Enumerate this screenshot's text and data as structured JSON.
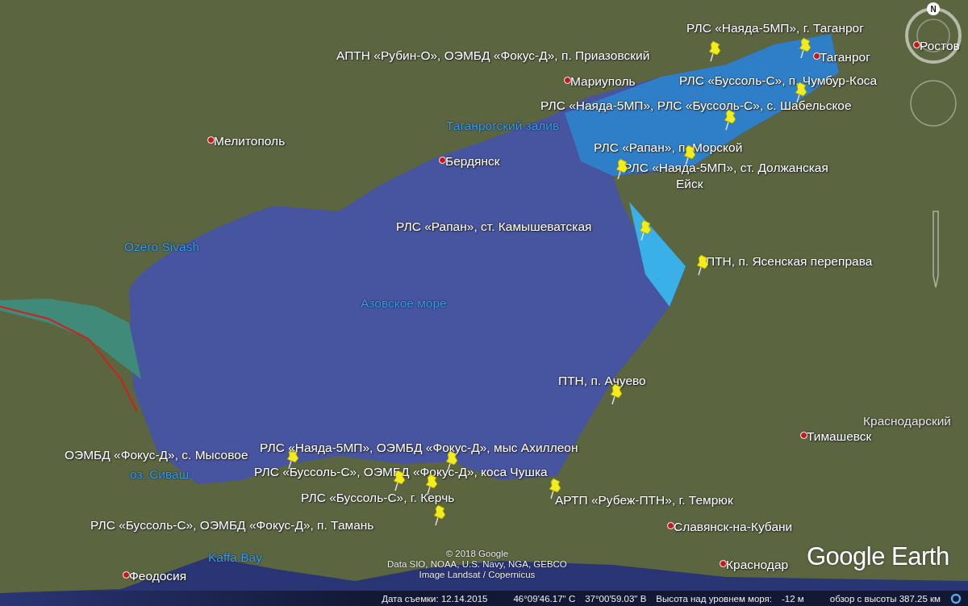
{
  "places": [
    {
      "text": "Таганрог",
      "kind": "city"
    },
    {
      "text": "Ростов",
      "kind": "city"
    },
    {
      "text": "Мариуполь",
      "kind": "city"
    },
    {
      "text": "Таганрогский залив",
      "kind": "water"
    },
    {
      "text": "Мелитополь",
      "kind": "city"
    },
    {
      "text": "Бердянск",
      "kind": "city"
    },
    {
      "text": "Ейск",
      "kind": "town"
    },
    {
      "text": "Ozero Sivash",
      "kind": "water"
    },
    {
      "text": "Азовское море",
      "kind": "water"
    },
    {
      "text": "Краснодарский",
      "kind": "region"
    },
    {
      "text": "Тимашевск",
      "kind": "city"
    },
    {
      "text": "оз. Сиваш",
      "kind": "water"
    },
    {
      "text": "Славянск-на-Кубани",
      "kind": "city"
    },
    {
      "text": "Kaffa Bay",
      "kind": "water"
    },
    {
      "text": "Феодосия",
      "kind": "city"
    },
    {
      "text": "Краснодар",
      "kind": "city"
    }
  ],
  "markers": [
    {
      "label": "РЛС «Наяда-5МП», г. Таганрог"
    },
    {
      "label": "АПТН «Рубин-О», ОЭМБД «Фокус-Д», п. Приазовский"
    },
    {
      "label": "РЛС «Буссоль-С», п. Чумбур-Коса"
    },
    {
      "label": "РЛС «Наяда-5МП», РЛС «Буссоль-С», с. Шабельское"
    },
    {
      "label": "РЛС «Рапан», п. Морской"
    },
    {
      "label": "РЛС «Наяда-5МП», ст. Должанская"
    },
    {
      "label": "РЛС «Рапан», ст. Камышеватская"
    },
    {
      "label": "ПТН, п. Ясенская переправа"
    },
    {
      "label": "ПТН, п. Ачуево"
    },
    {
      "label": "ОЭМБД «Фокус-Д», с. Мысовое"
    },
    {
      "label": "РЛС «Наяда-5МП», ОЭМБД «Фокус-Д», мыс Ахиллеон"
    },
    {
      "label": "РЛС «Буссоль-С», ОЭМБД «Фокус-Д», коса Чушка"
    },
    {
      "label": "РЛС «Буссоль-С», г. Керчь"
    },
    {
      "label": "АРТП «Рубеж-ПТН», г. Темрюк"
    },
    {
      "label": "РЛС «Буссоль-С», ОЭМБД «Фокус-Д», п. Тамань"
    }
  ],
  "compass": {
    "north": "N"
  },
  "attribution": [
    "© 2018 Google",
    "Data SIO, NOAA, U.S. Navy, NGA, GEBCO",
    "Image Landsat / Copernicus"
  ],
  "logo": "Google Earth",
  "status_bar": {
    "imagery_date": "Дата съемки: 12.14.2015",
    "latitude": "46°09'46.17\" С",
    "longitude": "37°00'59.03\" В",
    "elevation_label": "Высота над уровнем моря:",
    "elevation": "-12 м",
    "eye_altitude": "обзор с высоты 387.25 км"
  }
}
